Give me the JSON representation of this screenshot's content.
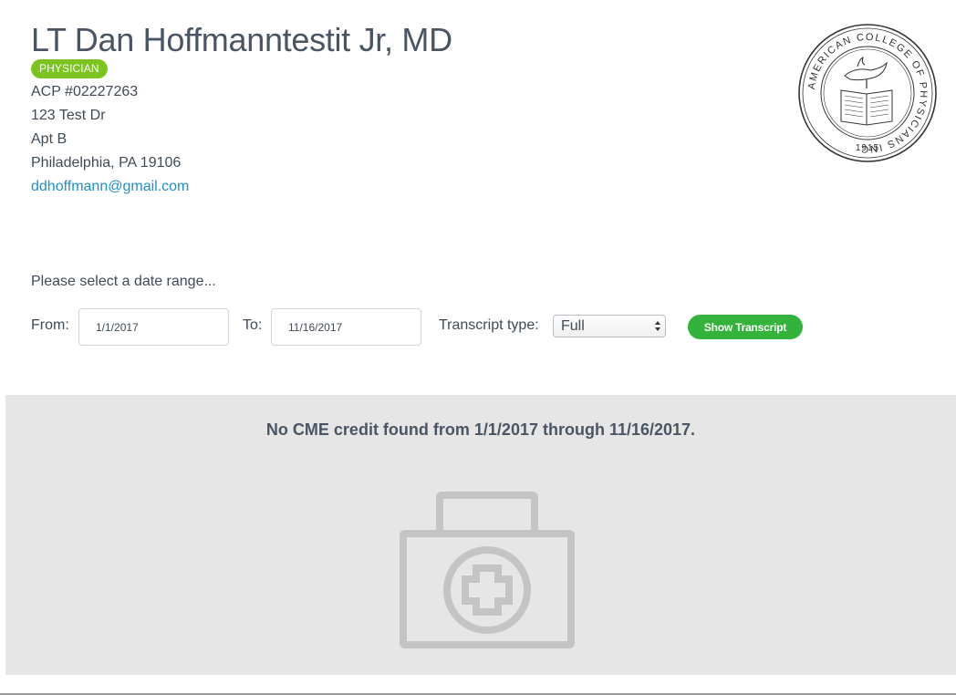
{
  "profile": {
    "name": "LT Dan Hoffmanntestit Jr, MD",
    "badge": "PHYSICIAN",
    "acp_number": "ACP #02227263",
    "address_line1": "123 Test Dr",
    "address_line2": "Apt B",
    "city_state_zip": "Philadelphia, PA 19106",
    "email": "ddhoffmann@gmail.com"
  },
  "seal": {
    "text": "AMERICAN COLLEGE OF PHYSICIANS INC",
    "year": "1915"
  },
  "filter": {
    "prompt": "Please select a date range...",
    "from_label": "From:",
    "from_value": "1/1/2017",
    "to_label": "To:",
    "to_value": "11/16/2017",
    "type_label": "Transcript type:",
    "type_value": "Full",
    "show_button": "Show Transcript"
  },
  "results": {
    "message": "No CME credit found from 1/1/2017 through 11/16/2017.",
    "empty_icon": "medical-kit-icon"
  },
  "colors": {
    "badge": "#7cc520",
    "button": "#33b33c",
    "link": "#1f8fc9",
    "panel": "#e6e6e6",
    "icon": "#c4c4c4"
  }
}
